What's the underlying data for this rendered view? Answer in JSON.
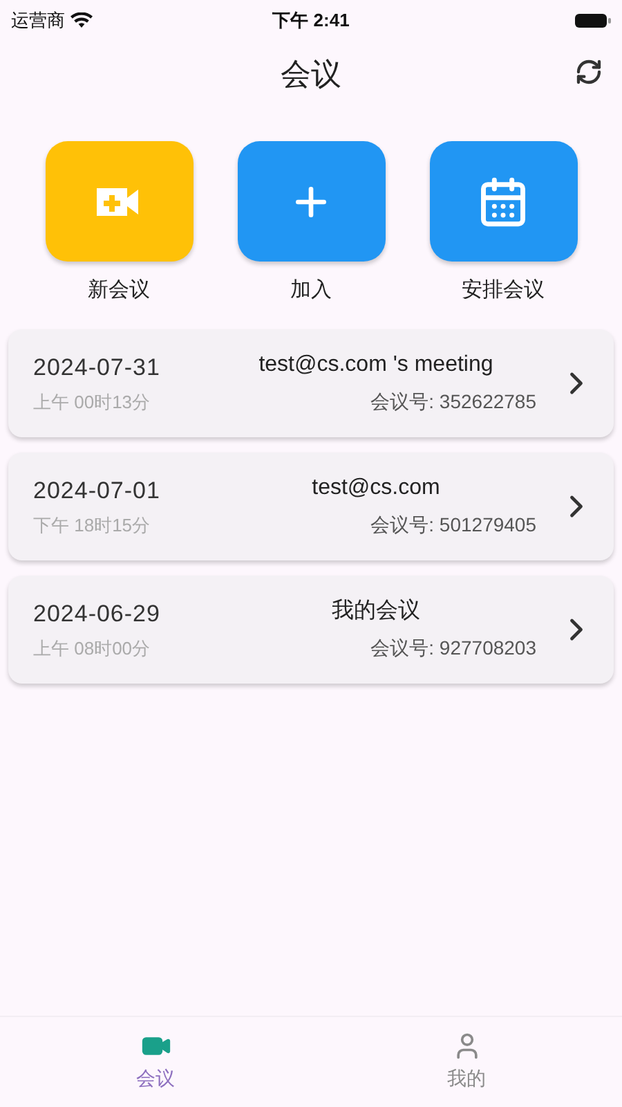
{
  "status_bar": {
    "carrier": "运营商",
    "time": "下午 2:41"
  },
  "header": {
    "title": "会议"
  },
  "actions": [
    {
      "kind": "new",
      "label": "新会议",
      "color": "#ffc107"
    },
    {
      "kind": "join",
      "label": "加入",
      "color": "#2196f3"
    },
    {
      "kind": "schedule",
      "label": "安排会议",
      "color": "#2196f3"
    }
  ],
  "meetings": [
    {
      "date": "2024-07-31",
      "time": "上午 00时13分",
      "title": "test@cs.com 's meeting",
      "number": "会议号: 352622785"
    },
    {
      "date": "2024-07-01",
      "time": "下午 18时15分",
      "title": "test@cs.com",
      "number": "会议号: 501279405"
    },
    {
      "date": "2024-06-29",
      "time": "上午 08时00分",
      "title": "我的会议",
      "number": "会议号: 927708203"
    }
  ],
  "tabs": [
    {
      "kind": "meeting",
      "label": "会议",
      "selected": true
    },
    {
      "kind": "me",
      "label": "我的",
      "selected": false
    }
  ]
}
